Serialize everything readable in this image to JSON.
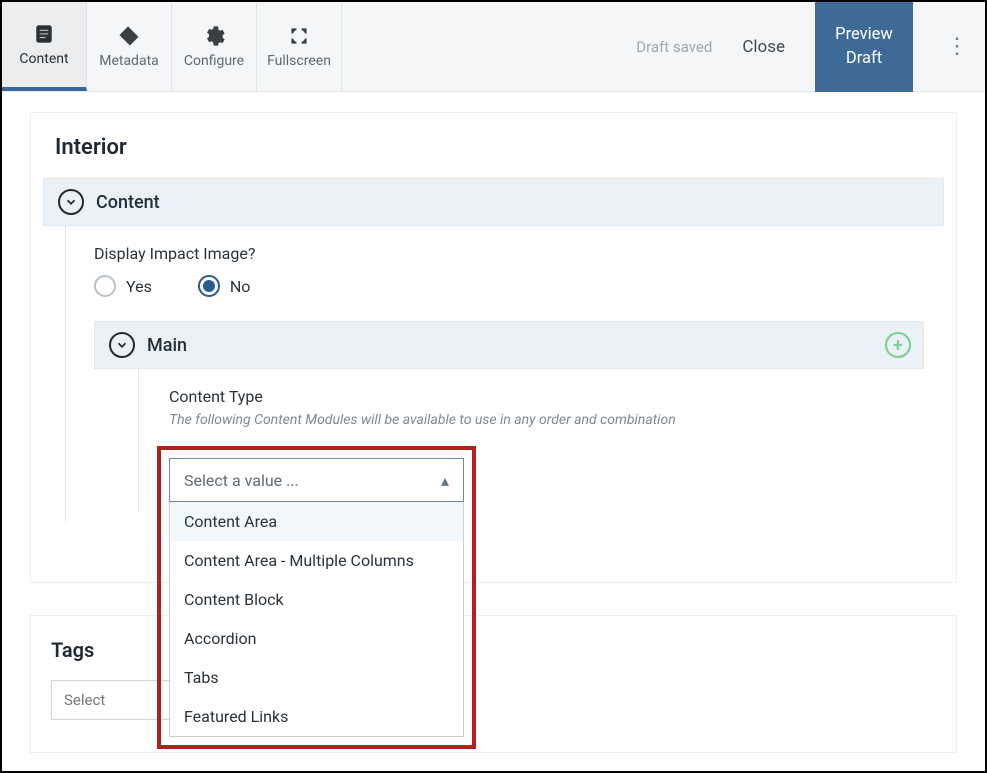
{
  "toolbar": {
    "tabs": [
      {
        "label": "Content"
      },
      {
        "label": "Metadata"
      },
      {
        "label": "Configure"
      },
      {
        "label": "Fullscreen"
      }
    ],
    "draft_status": "Draft saved",
    "close_label": "Close",
    "preview_label": "Preview\nDraft"
  },
  "page": {
    "title": "Interior"
  },
  "content_section": {
    "title": "Content",
    "impact_label": "Display Impact Image?",
    "options": {
      "yes": "Yes",
      "no": "No"
    },
    "selected": "no"
  },
  "main_section": {
    "title": "Main",
    "content_type_label": "Content Type",
    "help_text": "The following Content Modules will be available to use in any order and combination",
    "select_placeholder": "Select a value ...",
    "options": [
      "Content Area",
      "Content Area - Multiple Columns",
      "Content Block",
      "Accordion",
      "Tabs",
      "Featured Links"
    ]
  },
  "tags": {
    "title": "Tags",
    "placeholder": "Select"
  }
}
